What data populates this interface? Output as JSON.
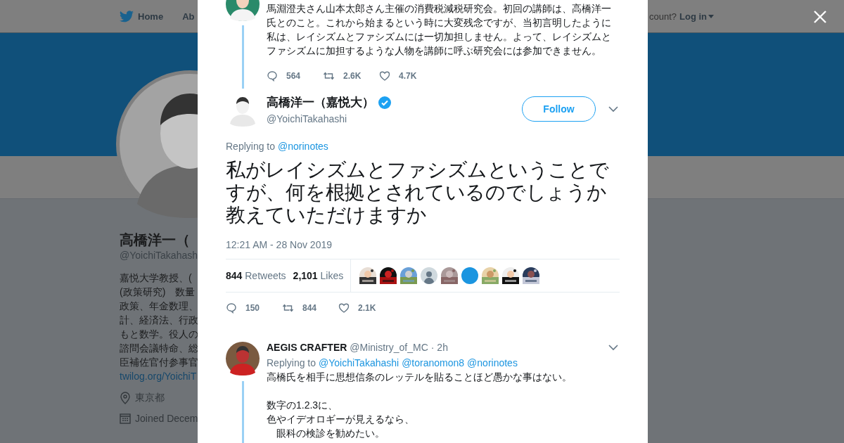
{
  "background_page": {
    "nav": {
      "items": [
        "Home",
        "Ab"
      ],
      "account_prompt": "count?",
      "login": "Log in"
    },
    "profile": {
      "name": "高橋洋一（",
      "handle": "@YoichiTakahash",
      "bio_lines": [
        "嘉悦大学教授、(",
        "(政策研究)　数量",
        "政策、年金数理、",
        "計、経済法、行政",
        "もと数学。役人の",
        "諮問会議特命、総",
        "臣補佐官付参事官"
      ],
      "link": "twilog.org/YoichiT",
      "location": "東京都",
      "joined": "Joined Decem"
    }
  },
  "modal": {
    "parent_tweet": {
      "text": "馬淵澄夫さん山本太郎さん主催の消費税減税研究会。初回の講師は、高橋洋一氏とのこと。これから始まるという時に大変残念ですが、当初言明したように私は、レイシズムとファシズムには一切加担しません。よって、レイシズムとファシズムに加担するような人物を講師に呼ぶ研究会には参加できません。",
      "replies": "564",
      "retweets": "2.6K",
      "likes": "4.7K"
    },
    "tweet": {
      "name": "高橋洋一（嘉悦大）",
      "verified": true,
      "handle": "@YoichiTakahashi",
      "follow": "Follow",
      "replying_label": "Replying to",
      "replying_to": [
        "@norinotes"
      ],
      "text": "私がレイシズムとファシズムということですが、何を根拠とされているのでしょうか教えていただけますか",
      "time": "12:21 AM - 28 Nov 2019",
      "retweet_count": "844",
      "retweet_label": "Retweets",
      "like_count": "2,101",
      "like_label": "Likes",
      "liked_by": [
        {
          "kind": "picture"
        },
        {
          "kind": "picture"
        },
        {
          "kind": "picture"
        },
        {
          "kind": "default"
        },
        {
          "kind": "picture"
        },
        {
          "kind": "blank"
        },
        {
          "kind": "picture"
        },
        {
          "kind": "picture"
        },
        {
          "kind": "picture"
        }
      ],
      "replies": "150",
      "retweets": "844",
      "likes": "2.1K"
    },
    "reply": {
      "name": "AEGIS CRAFTER",
      "handle": "@Ministry_of_MC",
      "time": "· 2h",
      "replying_label": "Replying to",
      "replying_to": [
        "@YoichiTakahashi",
        "@toranomon8",
        "@norinotes"
      ],
      "paragraphs": [
        [
          "高橋氏を相手に思想信条のレッテルを貼ることほど愚かな事はない。"
        ],
        [
          "数字の1.2.3に、",
          "色やイデオロギーが見えるなら、",
          "　眼科の検診を勧めたい。"
        ]
      ]
    }
  }
}
